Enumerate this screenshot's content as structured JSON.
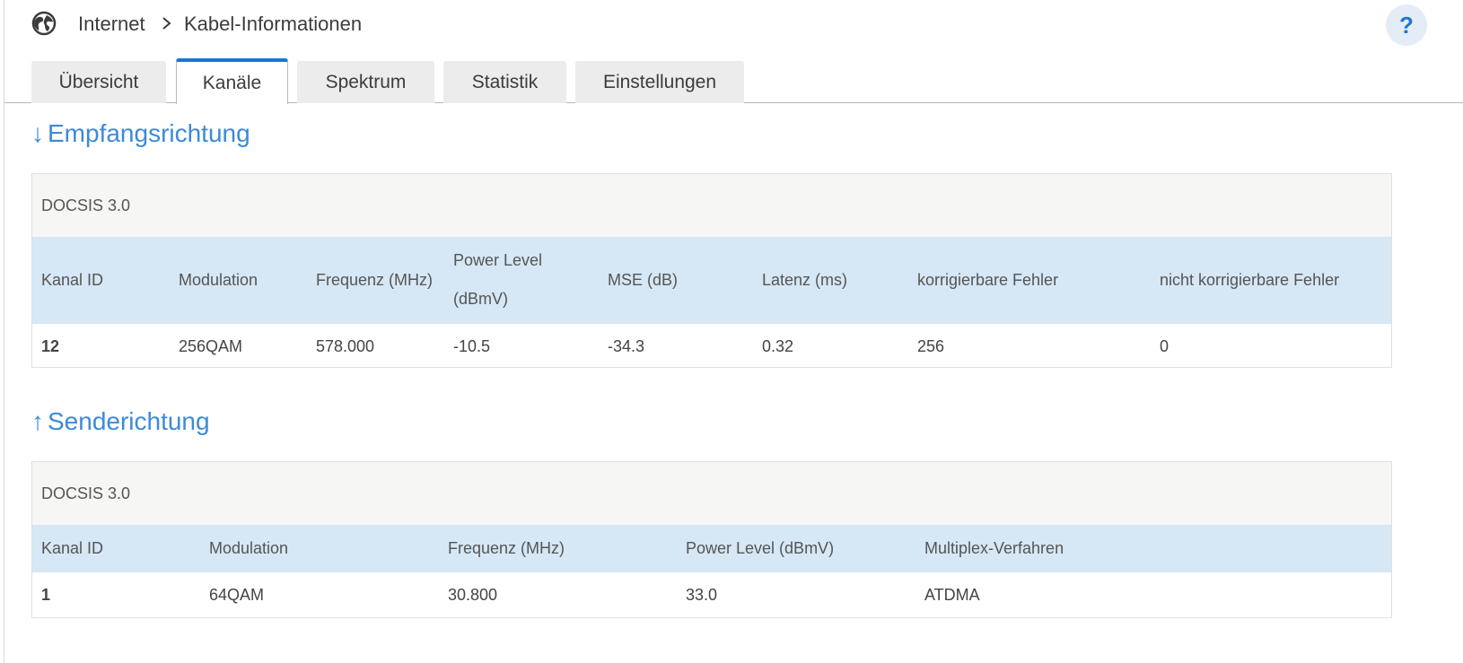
{
  "breadcrumb": {
    "icon": "globe-icon",
    "parent": "Internet",
    "separator_icon": "chevron-right-icon",
    "current": "Kabel-Informationen"
  },
  "help_label": "?",
  "tabs": [
    {
      "label": "Übersicht",
      "active": false
    },
    {
      "label": "Kanäle",
      "active": true
    },
    {
      "label": "Spektrum",
      "active": false
    },
    {
      "label": "Statistik",
      "active": false
    },
    {
      "label": "Einstellungen",
      "active": false
    }
  ],
  "downstream": {
    "arrow": "↓",
    "title": "Empfangsrichtung",
    "caption": "DOCSIS 3.0",
    "headers": [
      "Kanal ID",
      "Modulation",
      "Frequenz (MHz)",
      "Power Level",
      "(dBmV)",
      "MSE (dB)",
      "Latenz (ms)",
      "korrigierbare Fehler",
      "nicht korrigierbare Fehler"
    ],
    "rows": [
      [
        "12",
        "256QAM",
        "578.000",
        "-10.5",
        "-34.3",
        "0.32",
        "256",
        "0"
      ]
    ]
  },
  "upstream": {
    "arrow": "↑",
    "title": "Senderichtung",
    "caption": "DOCSIS 3.0",
    "headers": [
      "Kanal ID",
      "Modulation",
      "Frequenz (MHz)",
      "Power Level (dBmV)",
      "Multiplex-Verfahren"
    ],
    "rows": [
      [
        "1",
        "64QAM",
        "30.800",
        "33.0",
        "ATDMA"
      ]
    ]
  },
  "colors": {
    "accent": "#1b77d0",
    "section_title": "#3c8ad8",
    "header_row": "#d6e7f5",
    "caption_row": "#f6f6f4"
  }
}
